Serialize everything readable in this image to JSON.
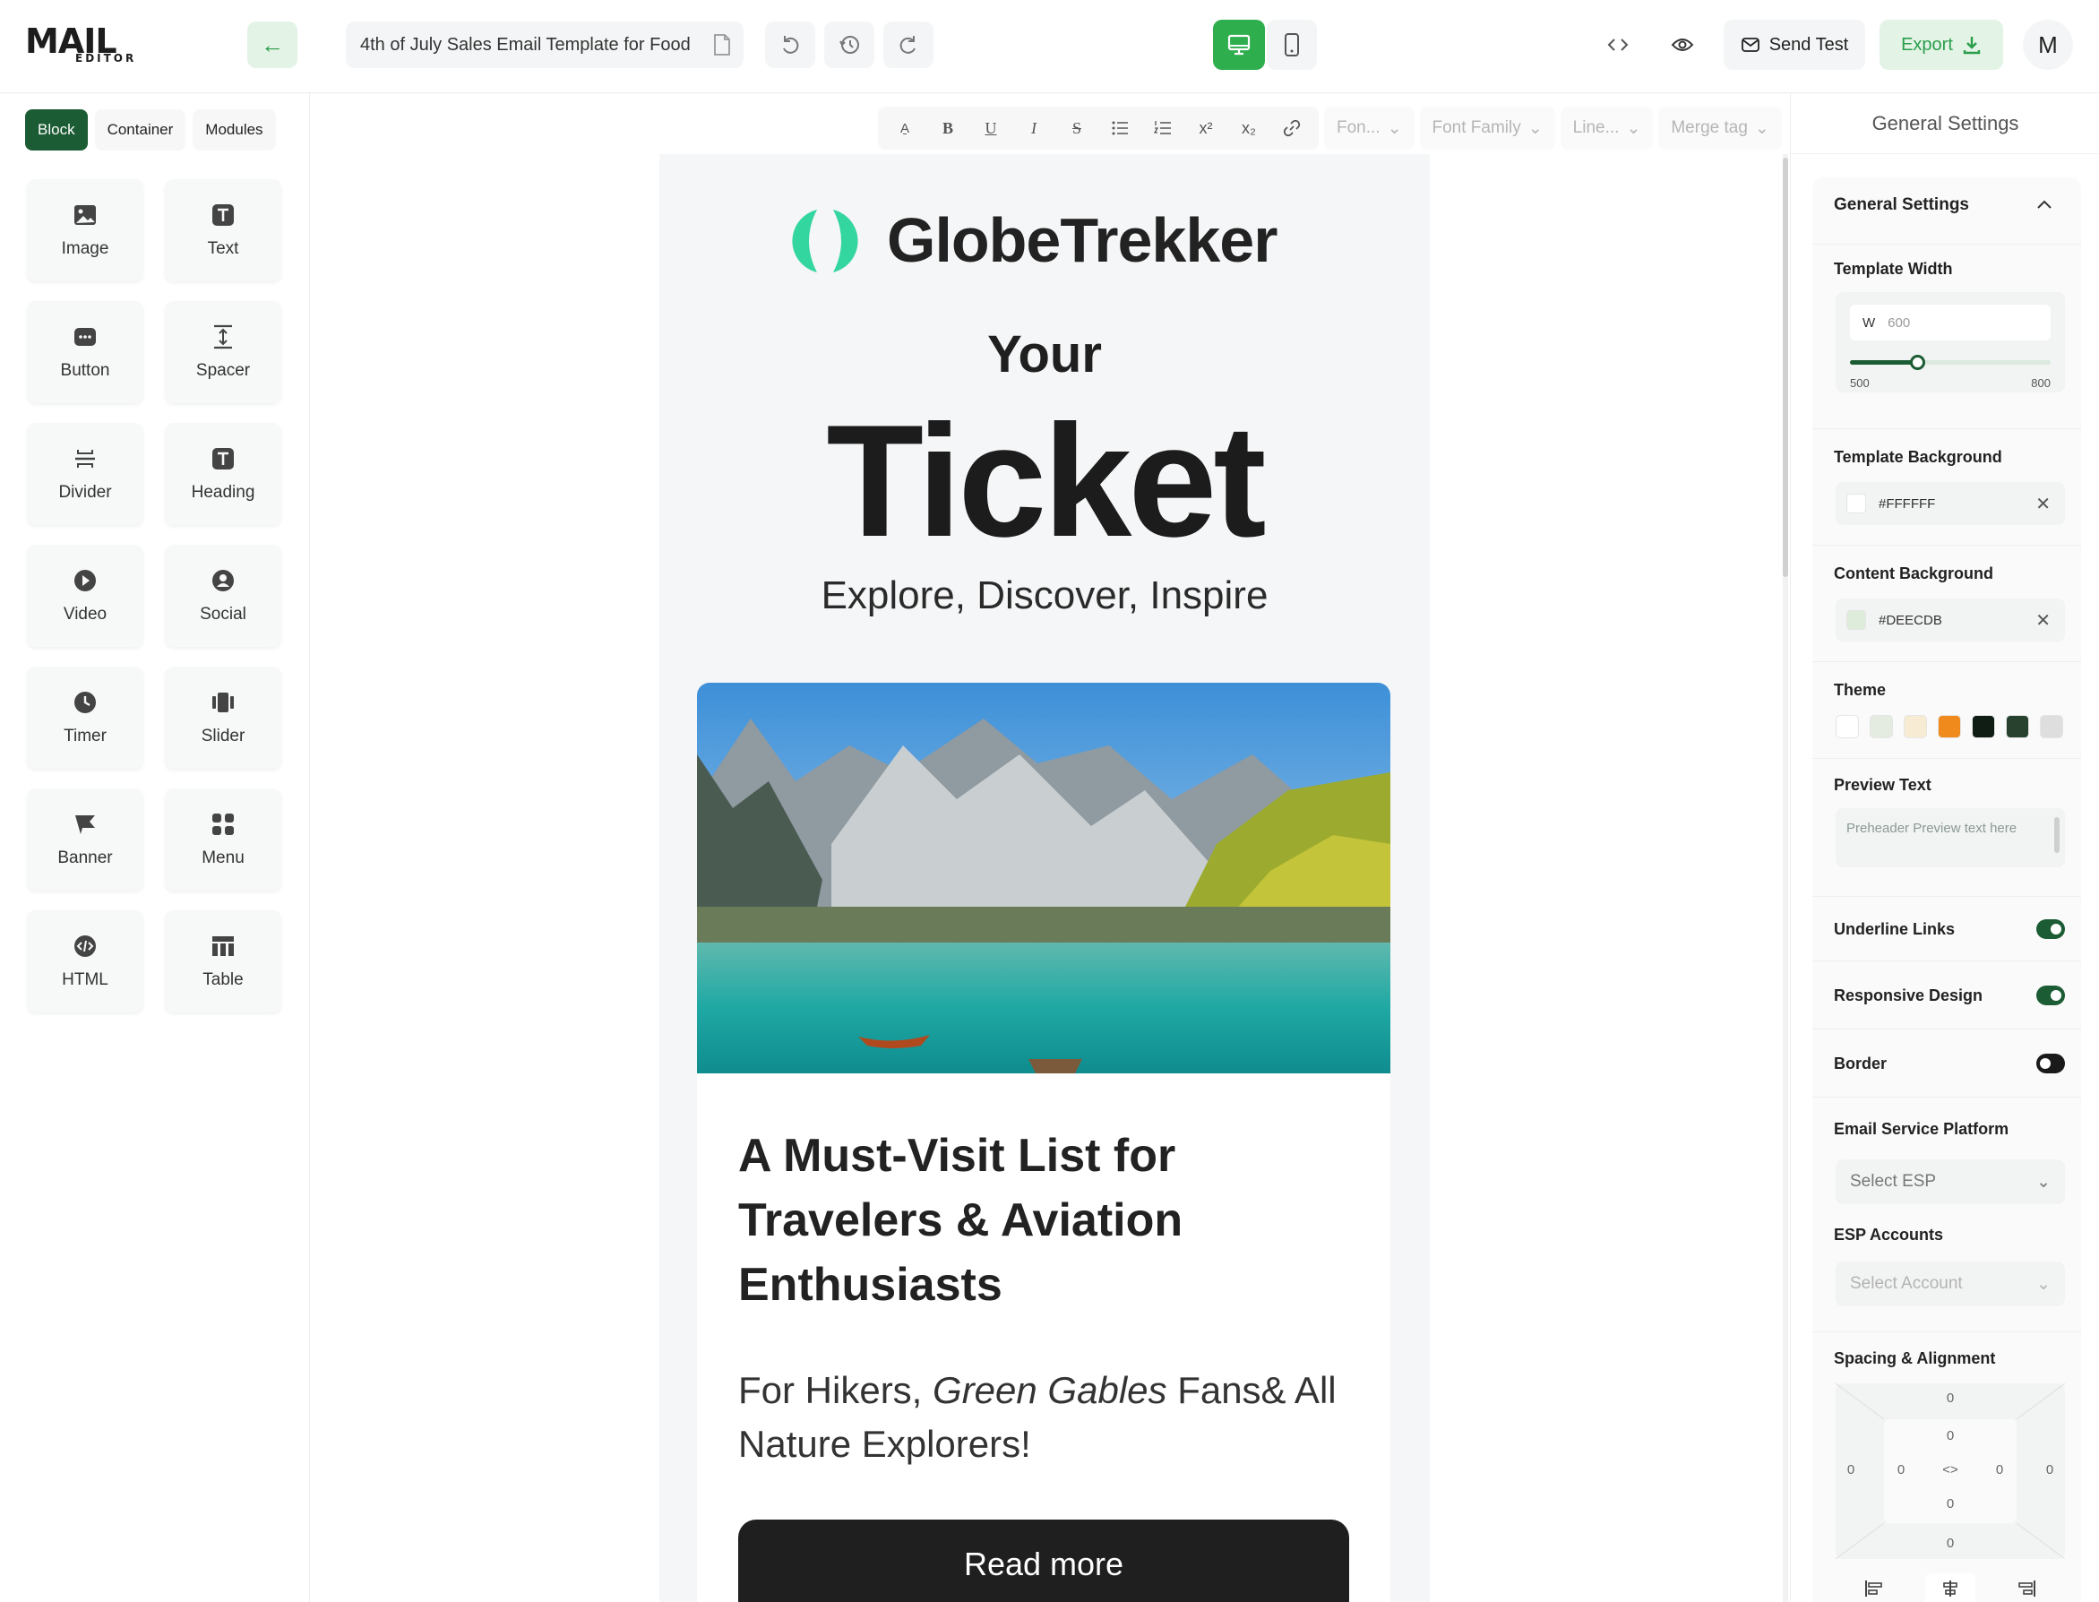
{
  "app": {
    "logo_top": "MAIL",
    "logo_bottom": "EDITOR",
    "template_title": "4th of July Sales Email Template for Food",
    "send_test_label": "Send Test",
    "export_label": "Export",
    "avatar_initial": "M"
  },
  "left_panel": {
    "tabs": [
      {
        "label": "Block",
        "active": true
      },
      {
        "label": "Container",
        "active": false
      },
      {
        "label": "Modules",
        "active": false
      }
    ],
    "blocks": [
      {
        "label": "Image",
        "icon": "image-icon"
      },
      {
        "label": "Text",
        "icon": "text-icon"
      },
      {
        "label": "Button",
        "icon": "button-icon"
      },
      {
        "label": "Spacer",
        "icon": "spacer-icon"
      },
      {
        "label": "Divider",
        "icon": "divider-icon"
      },
      {
        "label": "Heading",
        "icon": "heading-icon"
      },
      {
        "label": "Video",
        "icon": "video-icon"
      },
      {
        "label": "Social",
        "icon": "social-icon"
      },
      {
        "label": "Timer",
        "icon": "timer-icon"
      },
      {
        "label": "Slider",
        "icon": "slider-icon"
      },
      {
        "label": "Banner",
        "icon": "banner-icon"
      },
      {
        "label": "Menu",
        "icon": "menu-icon"
      },
      {
        "label": "HTML",
        "icon": "html-icon"
      },
      {
        "label": "Table",
        "icon": "table-icon"
      }
    ]
  },
  "toolbar": {
    "font_size_placeholder": "Fon...",
    "font_family_placeholder": "Font Family",
    "line_height_placeholder": "Line...",
    "merge_tag_placeholder": "Merge tag"
  },
  "email": {
    "brand": "GlobeTrekker",
    "hero_line1": "Your",
    "hero_line2": "Ticket",
    "hero_sub": "Explore, Discover, Inspire",
    "card_heading": "A Must-Visit List for Travelers & Aviation Enthusiasts",
    "card_text_pre": "For Hikers,",
    "card_text_em": "Green Gables",
    "card_text_post": "Fans& All Nature Explorers!",
    "cta": "Read more"
  },
  "settings": {
    "panel_title": "General Settings",
    "section_title": "General Settings",
    "template_width_label": "Template Width",
    "width_prefix": "W",
    "width_value": "600",
    "width_min": "500",
    "width_max": "800",
    "template_bg_label": "Template Background",
    "template_bg_value": "#FFFFFF",
    "content_bg_label": "Content Background",
    "content_bg_value": "#DEECDB",
    "theme_label": "Theme",
    "theme_colors": [
      "#ffffff",
      "#e4ece2",
      "#f7ecd3",
      "#f08a1c",
      "#0f1d14",
      "#28412f",
      "#dedede"
    ],
    "preview_text_label": "Preview Text",
    "preview_text_placeholder": "Preheader Preview text here",
    "underline_links_label": "Underline Links",
    "underline_links_on": true,
    "responsive_design_label": "Responsive Design",
    "responsive_design_on": true,
    "border_label": "Border",
    "border_on": false,
    "esp_label": "Email Service Platform",
    "esp_placeholder": "Select ESP",
    "esp_accounts_label": "ESP Accounts",
    "esp_accounts_placeholder": "Select Account",
    "spacing_label": "Spacing & Alignment",
    "margin_top": "0",
    "margin_left": "0",
    "margin_right": "0",
    "margin_bottom": "0",
    "padding_top": "0",
    "padding_left": "0",
    "padding_right": "0",
    "padding_bottom": "0"
  },
  "colors": {
    "accent": "#2fae4e",
    "dark_green": "#1c5c34"
  }
}
